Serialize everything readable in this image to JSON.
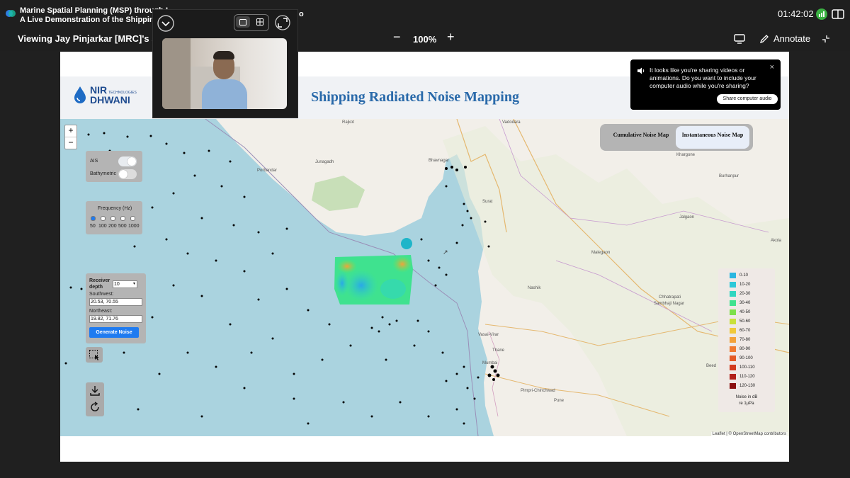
{
  "meeting": {
    "title_line1": "Marine Spatial Planning (MSP) through I",
    "title_line2": "A Live Demonstration of the Shipping Ra",
    "title_suffix": "o",
    "clock": "01:42:02"
  },
  "viewbar": {
    "viewing_label": "Viewing Jay Pinjarkar [MRC]'s scre",
    "zoom_minus": "−",
    "zoom_value": "100%",
    "zoom_plus": "+",
    "annotate_label": "Annotate"
  },
  "toast": {
    "message": "It looks like you're sharing videos or animations. Do you want to include your computer audio while you're sharing?",
    "button": "Share computer audio",
    "close": "×"
  },
  "app": {
    "brand_name_1": "NIR",
    "brand_name_2": "DHWANI",
    "brand_sub": "TECHNOLOGIES",
    "title": "Shipping Radiated Noise Mapping",
    "tabs": [
      "Cumulative Noise Map",
      "Instantaneous Noise Map"
    ],
    "map_zoom_in": "+",
    "map_zoom_out": "−",
    "layers": {
      "ais": "AIS",
      "bathymetry": "Bathymetric"
    },
    "frequency": {
      "title": "Frequency (Hz)",
      "options": [
        "50",
        "100",
        "200",
        "500",
        "1000"
      ],
      "selected": "50"
    },
    "receiver": {
      "label_1": "Receiver",
      "label_2": "depth",
      "depth_value": "10",
      "southwest_label": "Southwest:",
      "southwest_value": "20.53, 70.55",
      "northeast_label": "Northeast:",
      "northeast_value": "19.82, 71.76",
      "generate_button": "Generate Noise"
    },
    "legend": {
      "items": [
        {
          "label": "0-10",
          "color": "#29b6e0"
        },
        {
          "label": "10-20",
          "color": "#2bc8d8"
        },
        {
          "label": "20-30",
          "color": "#30d6c0"
        },
        {
          "label": "30-40",
          "color": "#3fe28f"
        },
        {
          "label": "40-50",
          "color": "#7de04a"
        },
        {
          "label": "50-60",
          "color": "#c9e03a"
        },
        {
          "label": "60-70",
          "color": "#f0c93a"
        },
        {
          "label": "70-80",
          "color": "#f3a23a"
        },
        {
          "label": "80-90",
          "color": "#f07a30"
        },
        {
          "label": "90-100",
          "color": "#e45a25"
        },
        {
          "label": "100-110",
          "color": "#d23a1c"
        },
        {
          "label": "110-120",
          "color": "#b2201a"
        },
        {
          "label": "120-130",
          "color": "#8a1010"
        }
      ],
      "foot_1": "Noise in dB",
      "foot_2": "re 1μPa"
    },
    "attribution": "Leaflet | © OpenStreetMap contributors",
    "places": [
      "Vadodara",
      "Rajkot",
      "Bhavnagar",
      "Surat",
      "Khargone",
      "Burhanpur",
      "Jalgaon",
      "Malegaon",
      "Akola",
      "Nashik",
      "Chhatrapati",
      "Sambhaji Nagar",
      "Vasai-Virar",
      "Thane",
      "Mumbai",
      "Pimpri-Chinchwad",
      "Pune",
      "Beed",
      "Porbandar",
      "Junagadh"
    ]
  }
}
